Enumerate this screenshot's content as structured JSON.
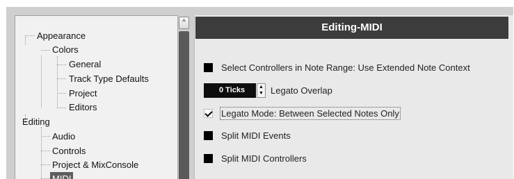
{
  "tree": {
    "items": [
      {
        "label": "Appearance"
      },
      {
        "label": "Colors"
      },
      {
        "label": "General"
      },
      {
        "label": "Track Type Defaults"
      },
      {
        "label": "Project"
      },
      {
        "label": "Editors"
      },
      {
        "label": "Editing"
      },
      {
        "label": "Audio"
      },
      {
        "label": "Controls"
      },
      {
        "label": "Project & MixConsole"
      },
      {
        "label": "MIDI",
        "selected": true
      }
    ]
  },
  "scrollbar": {
    "up_arrow": "^"
  },
  "panel": {
    "title": "Editing-MIDI",
    "options": [
      {
        "label": "Select Controllers in Note Range: Use Extended Note Context",
        "checked": false
      },
      {
        "label": "Legato Mode: Between Selected Notes Only",
        "checked": true
      },
      {
        "label": "Split MIDI Events",
        "checked": false
      },
      {
        "label": "Split MIDI Controllers",
        "checked": false
      }
    ],
    "legato_overlap": {
      "value": "0 Ticks",
      "label": "Legato Overlap"
    }
  },
  "icons": {
    "checkbox_checked": "check-icon",
    "spinner": "up-down-arrows-icon"
  }
}
